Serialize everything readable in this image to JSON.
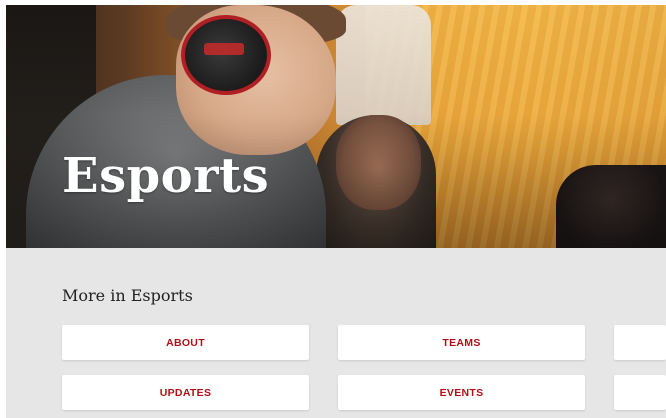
{
  "hero": {
    "title": "Esports"
  },
  "subnav": {
    "heading": "More in Esports",
    "items": [
      {
        "label": "ABOUT"
      },
      {
        "label": "TEAMS"
      },
      {
        "label": ""
      },
      {
        "label": "UPDATES"
      },
      {
        "label": "EVENTS"
      },
      {
        "label": ""
      }
    ]
  },
  "colors": {
    "accent": "#b30d16",
    "subnav_background": "#e6e6e6",
    "button_background": "#ffffff"
  }
}
